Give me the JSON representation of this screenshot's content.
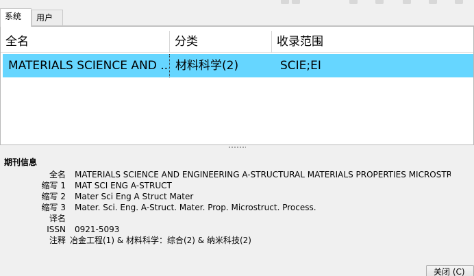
{
  "tabs": [
    {
      "label": "系统",
      "active": true
    },
    {
      "label": "用户",
      "active": false
    }
  ],
  "table": {
    "headers": [
      "全名",
      "分类",
      "收录范围"
    ],
    "rows": [
      {
        "fullname": "MATERIALS SCIENCE AND ...",
        "category": "材料科学(2)",
        "coverage": "SCIE;EI",
        "selected": true
      }
    ]
  },
  "info": {
    "title": "期刊信息",
    "fields": [
      {
        "label": "全名",
        "value": "MATERIALS SCIENCE AND ENGINEERING A-STRUCTURAL MATERIALS PROPERTIES MICROSTR"
      },
      {
        "label": "缩写 1",
        "value": "MAT SCI ENG A-STRUCT"
      },
      {
        "label": "缩写 2",
        "value": "Mater Sci Eng A Struct Mater"
      },
      {
        "label": "缩写 3",
        "value": "Mater. Sci. Eng. A-Struct. Mater. Prop. Microstruct. Process."
      },
      {
        "label": "译名",
        "value": ""
      },
      {
        "label": "ISSN",
        "value": "0921-5093"
      },
      {
        "label": "注释",
        "value": "冶金工程(1) & 材料科学：综合(2) & 纳米科技(2)"
      }
    ]
  },
  "buttons": {
    "close_label": "关闭 (C)"
  },
  "colors": {
    "selected_row": "#66d6ff",
    "background": "#f0f0f0"
  }
}
